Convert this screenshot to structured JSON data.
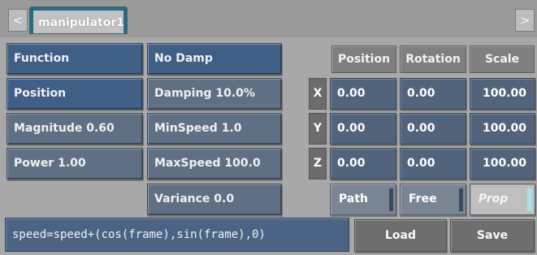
{
  "tabs": {
    "left_arrow": "<",
    "right_arrow": ">",
    "active_label": "manipulator1"
  },
  "left_column": {
    "function": "Function",
    "position": "Position",
    "magnitude": "Magnitude 0.60",
    "power": "Power 1.00"
  },
  "middle_column": {
    "damp": "No Damp",
    "damping": "Damping 10.0%",
    "min_speed": "MinSpeed 1.0",
    "max_speed": "MaxSpeed 100.0",
    "variance": "Variance 0.0"
  },
  "grid": {
    "headers": [
      "Position",
      "Rotation",
      "Scale"
    ],
    "rows": [
      {
        "axis": "X",
        "position": "0.00",
        "rotation": "0.00",
        "scale": "100.00"
      },
      {
        "axis": "Y",
        "position": "0.00",
        "rotation": "0.00",
        "scale": "100.00"
      },
      {
        "axis": "Z",
        "position": "0.00",
        "rotation": "0.00",
        "scale": "100.00"
      }
    ]
  },
  "modes": {
    "path": "Path",
    "free": "Free",
    "prop": "Prop"
  },
  "expression": "speed=speed+(cos(frame),sin(frame),0)",
  "actions": {
    "load": "Load",
    "save": "Save"
  },
  "colors": {
    "active_button": "#3f5f86",
    "field": "#5f6f84",
    "tab_accent": "#1f6f8b",
    "prop_indicator": "#a9dfe6"
  }
}
